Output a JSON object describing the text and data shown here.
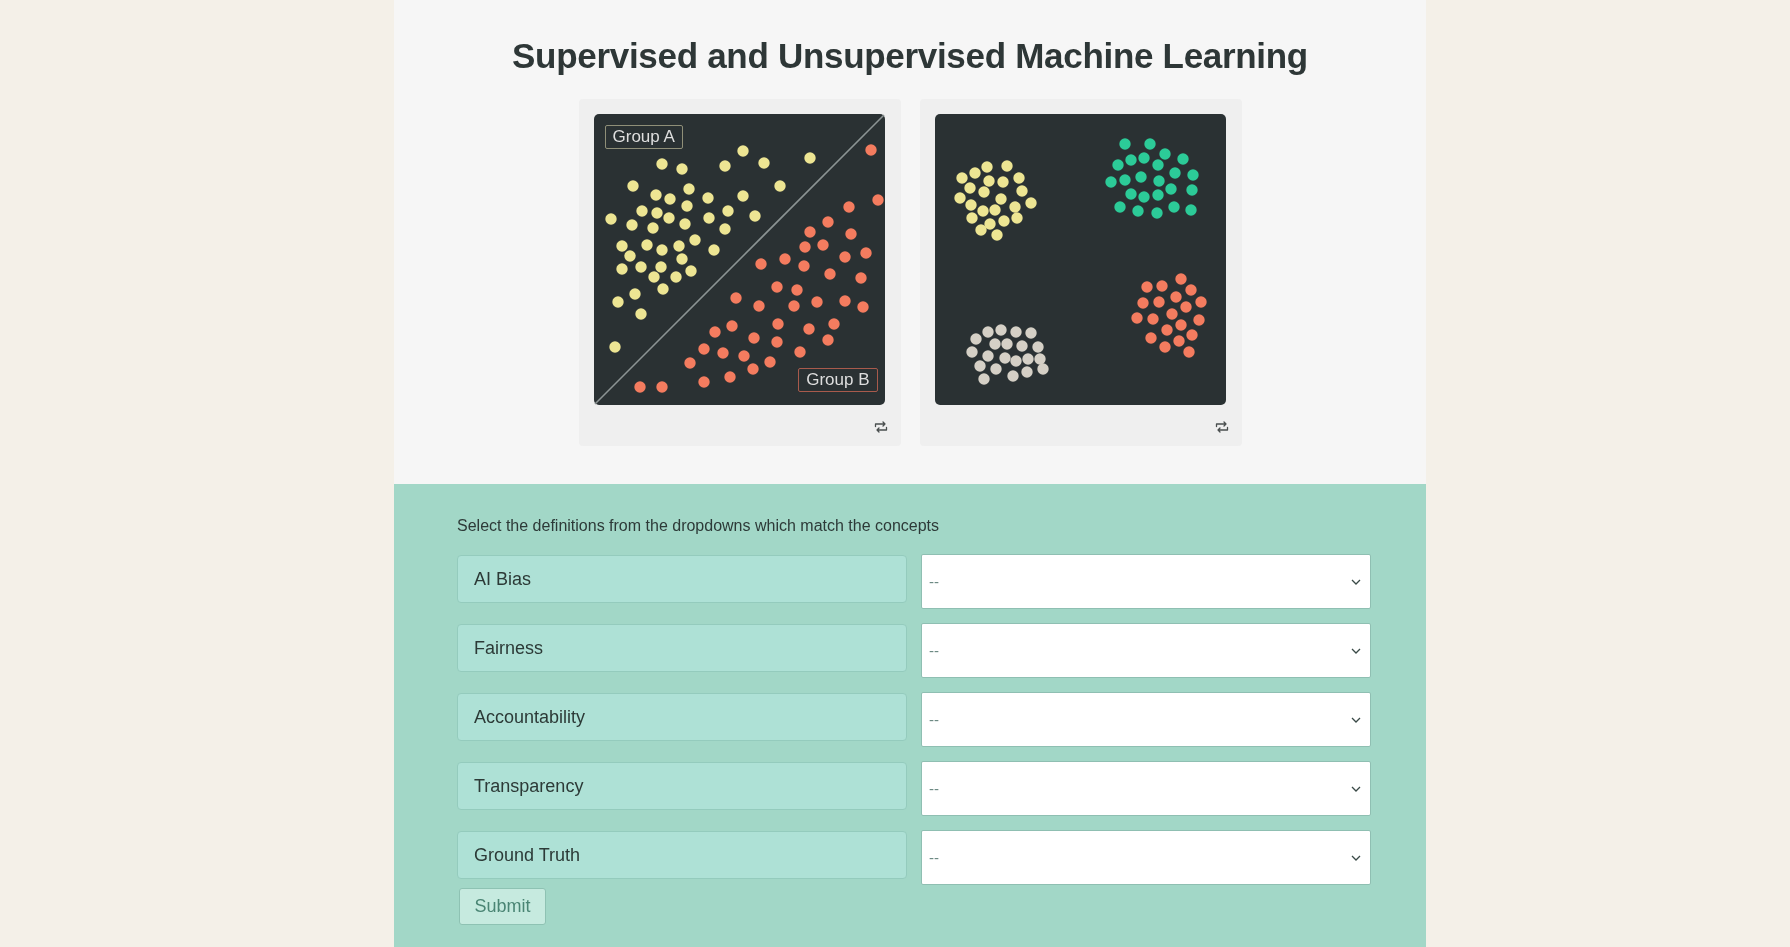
{
  "title": "Supervised and Unsupervised Machine Learning",
  "figures": [
    {
      "kind": "divided",
      "labels": [
        "Group A",
        "Group B"
      ]
    },
    {
      "kind": "clusters"
    }
  ],
  "quiz": {
    "instruction": "Select the definitions from the dropdowns which match the concepts",
    "rows": [
      {
        "concept": "AI Bias",
        "choice": "--"
      },
      {
        "concept": "Fairness",
        "choice": "--"
      },
      {
        "concept": "Accountability",
        "choice": "--"
      },
      {
        "concept": "Transparency",
        "choice": "--"
      },
      {
        "concept": "Ground Truth",
        "choice": "--"
      }
    ],
    "submit": {
      "label": "Submit",
      "disabled": true
    }
  }
}
